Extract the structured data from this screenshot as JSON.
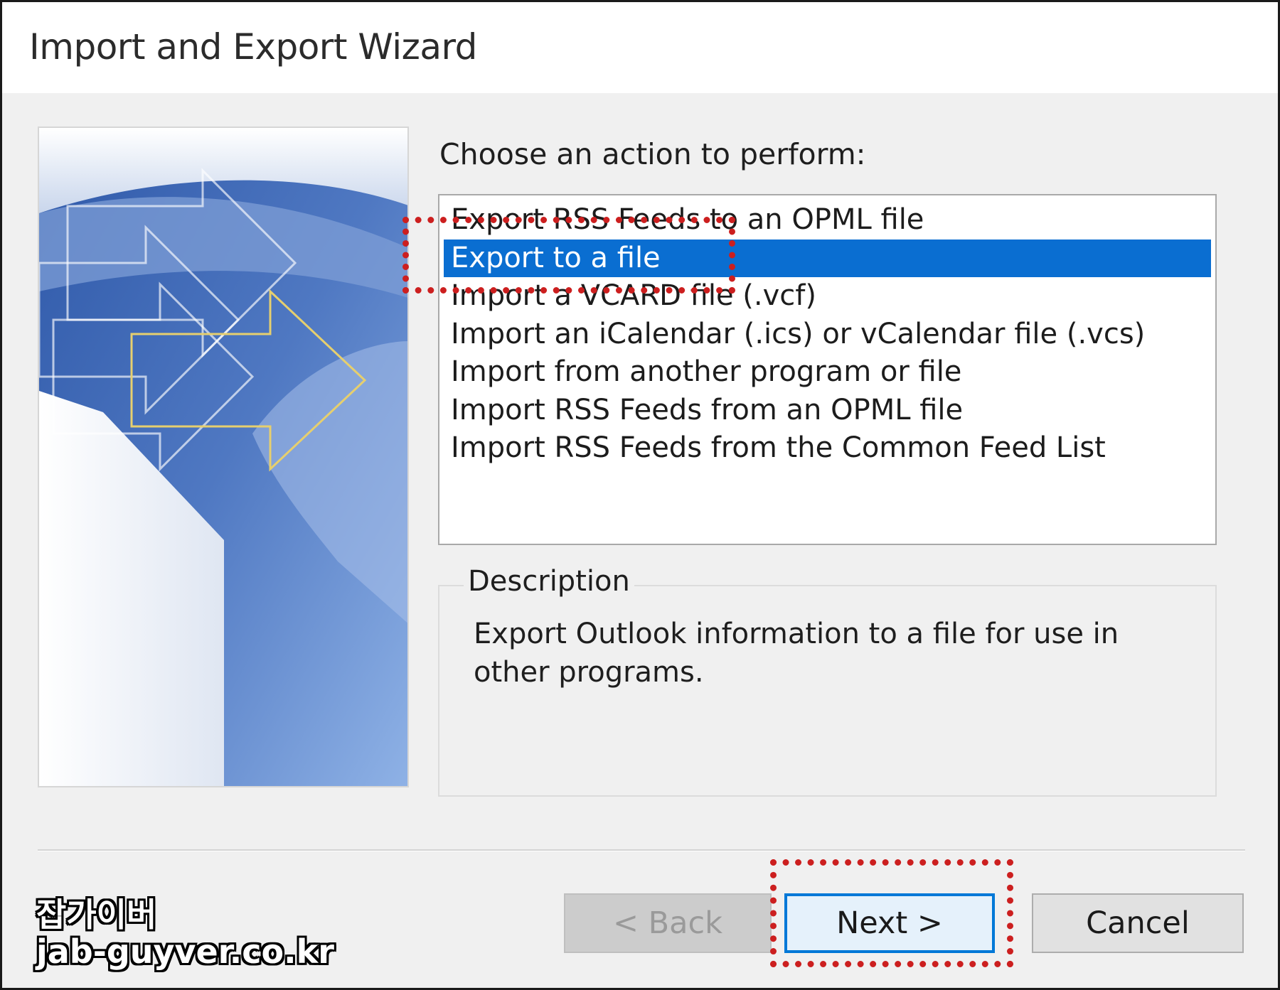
{
  "window": {
    "title": "Import and Export Wizard"
  },
  "prompt": "Choose an action to perform:",
  "actions": [
    {
      "label": "Export RSS Feeds to an OPML file",
      "selected": false
    },
    {
      "label": "Export to a file",
      "selected": true
    },
    {
      "label": "Import a VCARD file (.vcf)",
      "selected": false
    },
    {
      "label": "Import an iCalendar (.ics) or vCalendar file (.vcs)",
      "selected": false
    },
    {
      "label": "Import from another program or file",
      "selected": false
    },
    {
      "label": "Import RSS Feeds from an OPML file",
      "selected": false
    },
    {
      "label": "Import RSS Feeds from the Common Feed List",
      "selected": false
    }
  ],
  "description": {
    "legend": "Description",
    "text": "Export Outlook information to a file for use in other programs."
  },
  "buttons": {
    "back": "< Back",
    "next": "Next >",
    "cancel": "Cancel"
  },
  "colors": {
    "selection": "#0a6ed1",
    "highlight_annotation": "#cc1f1f",
    "default_button_border": "#0078d7"
  },
  "watermark": {
    "line1": "잡가이버",
    "line2": "jab-guyver.co.kr"
  }
}
